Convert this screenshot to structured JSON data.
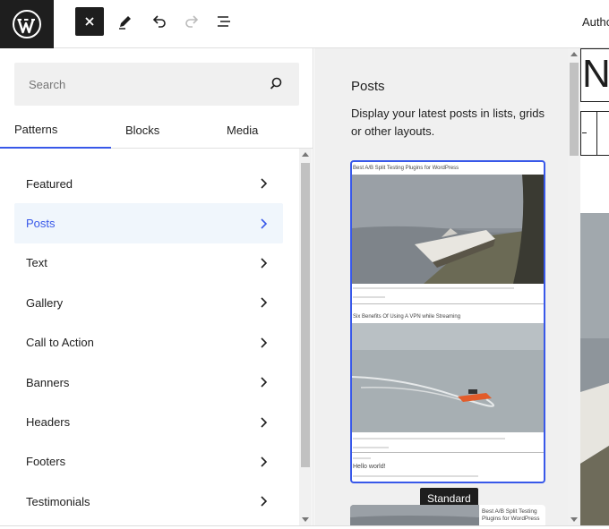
{
  "toolbar": {
    "close_icon": "close-icon",
    "author_label": "Autho"
  },
  "search": {
    "placeholder": "Search"
  },
  "tabs": [
    {
      "label": "Patterns"
    },
    {
      "label": "Blocks"
    },
    {
      "label": "Media"
    }
  ],
  "categories": [
    {
      "label": "Featured"
    },
    {
      "label": "Posts"
    },
    {
      "label": "Text"
    },
    {
      "label": "Gallery"
    },
    {
      "label": "Call to Action"
    },
    {
      "label": "Banners"
    },
    {
      "label": "Headers"
    },
    {
      "label": "Footers"
    },
    {
      "label": "Testimonials"
    }
  ],
  "preview": {
    "title": "Posts",
    "description": "Display your latest posts in lists, grids or other layouts.",
    "posts": [
      {
        "title": "Best A/B Split Testing Plugins for WordPress"
      },
      {
        "title": "Six Benefits Of Using A VPN while Streaming"
      },
      {
        "title": "Hello world!"
      }
    ],
    "tooltip": "Standard",
    "next_card_title": "Best A/B Split Testing Plugins for WordPress"
  },
  "canvas": {
    "title_fragment": "Na"
  },
  "colors": {
    "accent": "#3858e9",
    "dark": "#1e1e1e",
    "panel_bg": "#f0f0f0"
  }
}
